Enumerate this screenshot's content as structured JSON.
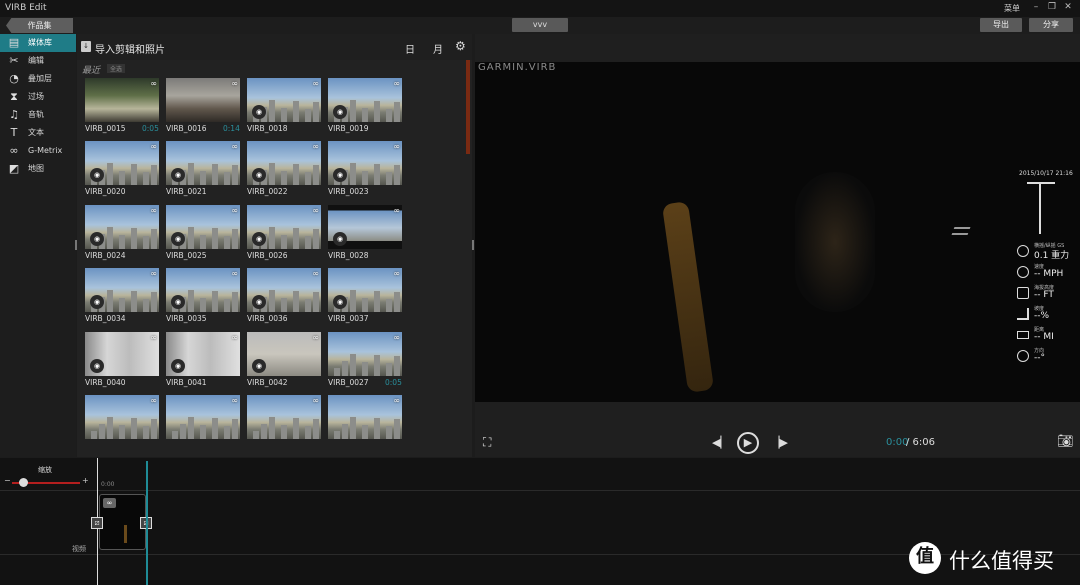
{
  "titlebar": {
    "app_title": "VIRB Edit",
    "menu_label": "菜单"
  },
  "toolbar": {
    "back_label": "作品集",
    "project_name": "vvv",
    "export_label": "导出",
    "share_label": "分享"
  },
  "sidebar": {
    "items": [
      {
        "label": "媒体库",
        "icon": "media-library-icon",
        "active": true
      },
      {
        "label": "编辑",
        "icon": "scissors-icon",
        "active": false
      },
      {
        "label": "叠加层",
        "icon": "gauge-icon",
        "active": false
      },
      {
        "label": "过场",
        "icon": "transition-icon",
        "active": false
      },
      {
        "label": "音轨",
        "icon": "music-note-icon",
        "active": false
      },
      {
        "label": "文本",
        "icon": "text-icon",
        "active": false
      },
      {
        "label": "G-Metrix",
        "icon": "g-metrix-icon",
        "active": false
      },
      {
        "label": "地图",
        "icon": "map-icon",
        "active": false
      }
    ]
  },
  "library": {
    "title": "导入剪辑和照片",
    "view_day": "日",
    "view_month": "月",
    "section_title": "最近",
    "section_sub": "全选",
    "items": [
      {
        "name": "VIRB_0015",
        "duration": "0:05",
        "kind": "video"
      },
      {
        "name": "VIRB_0016",
        "duration": "0:14",
        "kind": "video"
      },
      {
        "name": "VIRB_0018",
        "duration": "",
        "kind": "photo"
      },
      {
        "name": "VIRB_0019",
        "duration": "",
        "kind": "photo"
      },
      {
        "name": "VIRB_0020",
        "duration": "",
        "kind": "photo"
      },
      {
        "name": "VIRB_0021",
        "duration": "",
        "kind": "photo"
      },
      {
        "name": "VIRB_0022",
        "duration": "",
        "kind": "photo"
      },
      {
        "name": "VIRB_0023",
        "duration": "",
        "kind": "photo"
      },
      {
        "name": "VIRB_0024",
        "duration": "",
        "kind": "photo"
      },
      {
        "name": "VIRB_0025",
        "duration": "",
        "kind": "photo"
      },
      {
        "name": "VIRB_0026",
        "duration": "",
        "kind": "photo"
      },
      {
        "name": "VIRB_0028",
        "duration": "",
        "kind": "photo"
      },
      {
        "name": "VIRB_0034",
        "duration": "",
        "kind": "photo"
      },
      {
        "name": "VIRB_0035",
        "duration": "",
        "kind": "photo"
      },
      {
        "name": "VIRB_0036",
        "duration": "",
        "kind": "photo"
      },
      {
        "name": "VIRB_0037",
        "duration": "",
        "kind": "photo"
      },
      {
        "name": "VIRB_0040",
        "duration": "",
        "kind": "photo"
      },
      {
        "name": "VIRB_0041",
        "duration": "",
        "kind": "photo"
      },
      {
        "name": "VIRB_0042",
        "duration": "",
        "kind": "photo"
      },
      {
        "name": "VIRB_0027",
        "duration": "0:05",
        "kind": "video"
      },
      {
        "name": "",
        "duration": "",
        "kind": "video"
      },
      {
        "name": "",
        "duration": "",
        "kind": "video"
      },
      {
        "name": "",
        "duration": "",
        "kind": "video"
      },
      {
        "name": "",
        "duration": "",
        "kind": "video"
      }
    ]
  },
  "preview": {
    "watermark": "GARMIN.VIRB",
    "hud": {
      "datetime": "2015/10/17 21:16",
      "gforce_label": "横摇/纵摇 GS",
      "gforce_value": "0.1 重力",
      "speed_label": "速度",
      "speed_value": "-- MPH",
      "altitude_label": "海拔高度",
      "altitude_value": "-- FT",
      "grade_label": "坡度",
      "grade_value": "--%",
      "distance_label": "距离",
      "distance_value": "-- MI",
      "heading_label": "方向",
      "heading_value": "--°"
    },
    "time_current": "0:00",
    "time_total": "/ 6:06"
  },
  "timeline": {
    "zoom_label": "缩放",
    "zoom_minus": "−",
    "zoom_plus": "+",
    "ruler_start": "0:00",
    "track_label": "视频"
  },
  "brand": {
    "text": "什么值得买",
    "logo": "值"
  }
}
